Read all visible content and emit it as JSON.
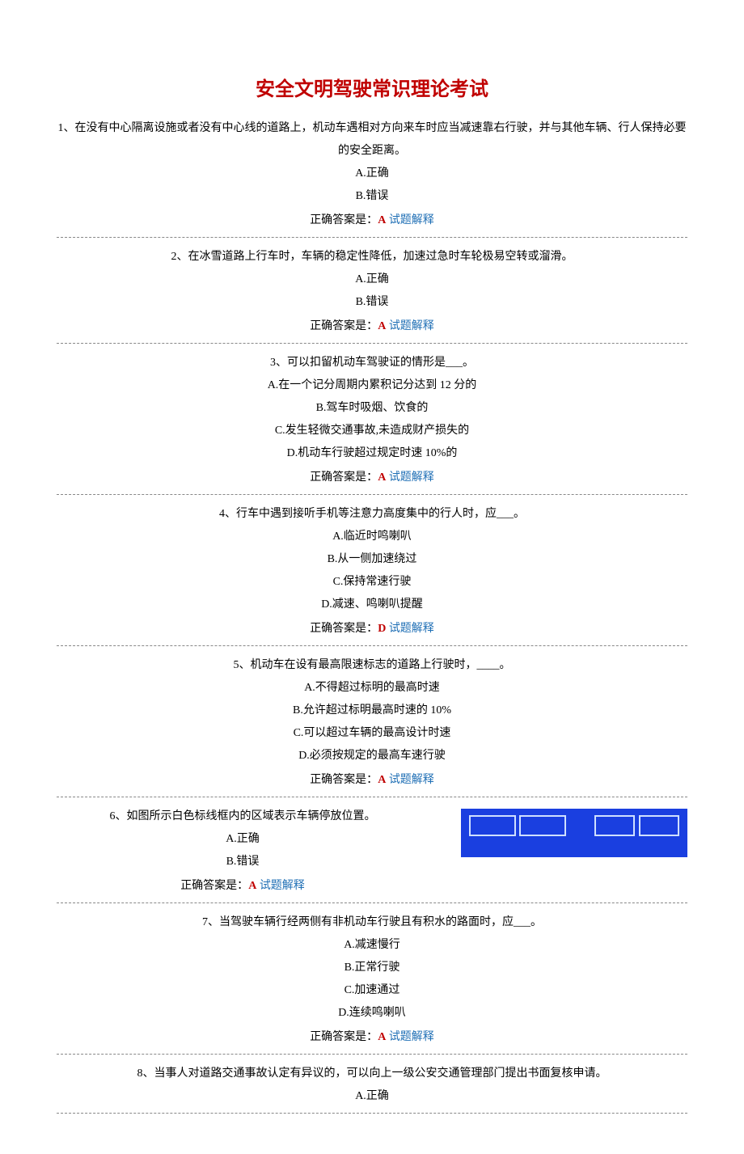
{
  "title": "安全文明驾驶常识理论考试",
  "answerPrefix": "正确答案是：",
  "explainLabel": "试题解释",
  "questions": [
    {
      "text": "1、在没有中心隔离设施或者没有中心线的道路上，机动车遇相对方向来车时应当减速靠右行驶，并与其他车辆、行人保持必要的安全距离。",
      "options": [
        "A.正确",
        "B.错误"
      ],
      "answer": "A"
    },
    {
      "text": "2、在冰雪道路上行车时，车辆的稳定性降低，加速过急时车轮极易空转或溜滑。",
      "options": [
        "A.正确",
        "B.错误"
      ],
      "answer": "A"
    },
    {
      "text": "3、可以扣留机动车驾驶证的情形是___。",
      "options": [
        "A.在一个记分周期内累积记分达到 12 分的",
        "B.驾车时吸烟、饮食的",
        "C.发生轻微交通事故,未造成财产损失的",
        "D.机动车行驶超过规定时速 10%的"
      ],
      "answer": "A"
    },
    {
      "text": "4、行车中遇到接听手机等注意力高度集中的行人时，应___。",
      "options": [
        "A.临近时鸣喇叭",
        "B.从一侧加速绕过",
        "C.保持常速行驶",
        "D.减速、鸣喇叭提醒"
      ],
      "answer": "D"
    },
    {
      "text": "5、机动车在设有最高限速标志的道路上行驶时，____。",
      "options": [
        "A.不得超过标明的最高时速",
        "B.允许超过标明最高时速的 10%",
        "C.可以超过车辆的最高设计时速",
        "D.必须按规定的最高车速行驶"
      ],
      "answer": "A"
    },
    {
      "text": "6、如图所示白色标线框内的区域表示车辆停放位置。",
      "options": [
        "A.正确",
        "B.错误"
      ],
      "answer": "A",
      "hasFigure": true
    },
    {
      "text": "7、当驾驶车辆行经两侧有非机动车行驶且有积水的路面时，应___。",
      "options": [
        "A.减速慢行",
        "B.正常行驶",
        "C.加速通过",
        "D.连续鸣喇叭"
      ],
      "answer": "A"
    },
    {
      "text": "8、当事人对道路交通事故认定有异议的，可以向上一级公安交通管理部门提出书面复核申请。",
      "options": [
        "A.正确"
      ],
      "answer": null
    }
  ]
}
